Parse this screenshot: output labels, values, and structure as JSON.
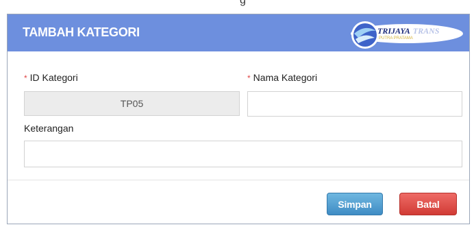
{
  "dialog": {
    "title": "TAMBAH KATEGORI",
    "logo": {
      "brand_a": "TRIJAYA",
      "brand_b": "TRANS",
      "tagline": "PUTRA PRATAMA"
    }
  },
  "form": {
    "id_kategori": {
      "required_mark": "*",
      "label": "ID Kategori",
      "value": "TP05"
    },
    "nama_kategori": {
      "required_mark": "*",
      "label": "Nama Kategori",
      "value": "",
      "placeholder": ""
    },
    "keterangan": {
      "label": "Keterangan",
      "value": "",
      "placeholder": ""
    }
  },
  "buttons": {
    "simpan": "Simpan",
    "batal": "Batal"
  },
  "colors": {
    "header": "#6d8fde",
    "simpan": "#4a98cc",
    "batal": "#dd4a44"
  }
}
